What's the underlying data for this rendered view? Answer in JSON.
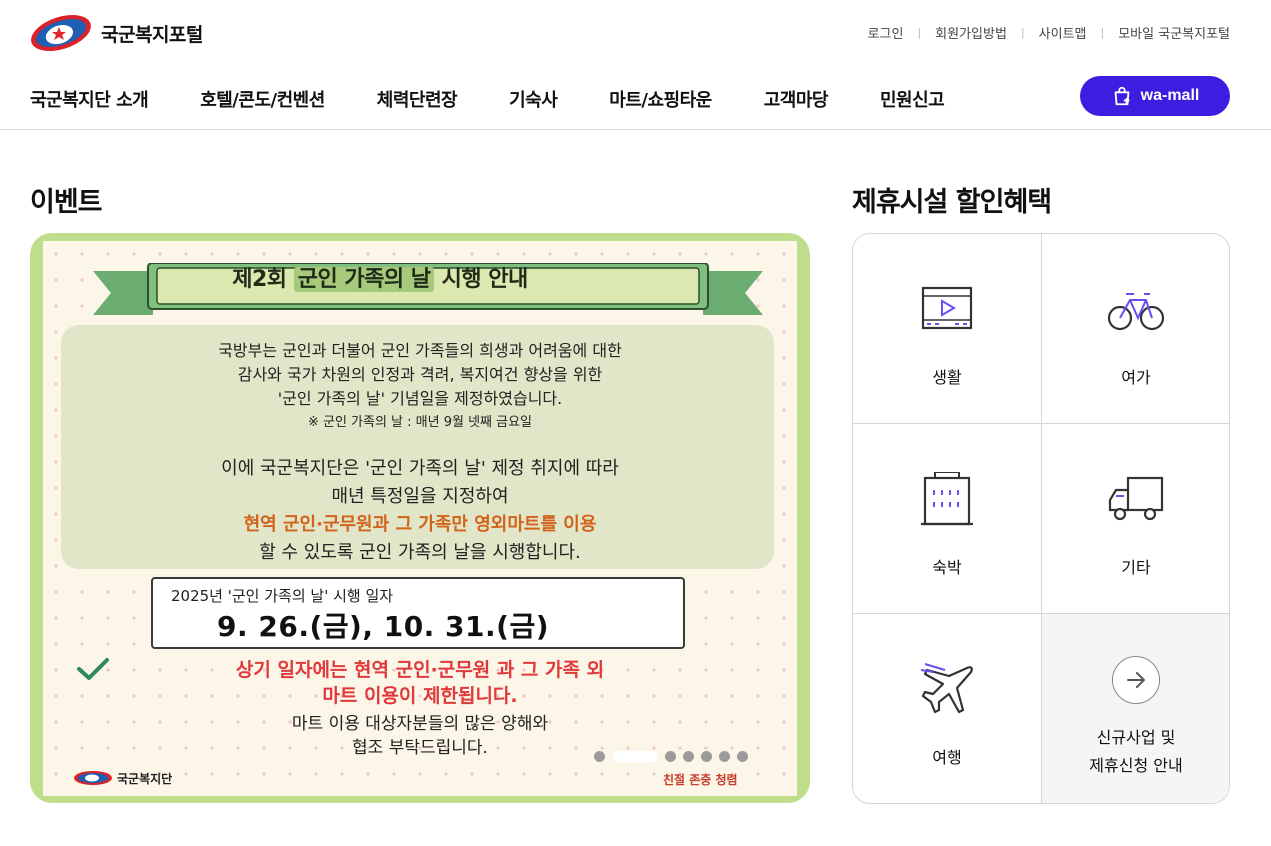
{
  "header": {
    "logo_text": "국군복지포털",
    "util_links": [
      "로그인",
      "회원가입방법",
      "사이트맵",
      "모바일 국군복지포털"
    ],
    "nav": [
      "국군복지단 소개",
      "호텔/콘도/컨벤션",
      "체력단련장",
      "기숙사",
      "마트/쇼핑타운",
      "고객마당",
      "민원신고"
    ],
    "wamall_label": "wa-mall",
    "wamall_color": "#3b1ee0"
  },
  "event": {
    "section_title": "이벤트",
    "banner": {
      "title_prefix": "제2회",
      "title_highlight": "군인 가족의 날",
      "title_suffix": "시행 안내",
      "intro_lines": [
        "국방부는 군인과 더불어 군인 가족들의 희생과 어려움에 대한",
        "감사와 국가 차원의 인정과 격려, 복지여건 향상을 위한",
        "'군인 가족의 날' 기념일을 제정하였습니다."
      ],
      "note": "※ 군인 가족의 날 : 매년 9월 넷째 금요일",
      "body_lines": [
        "이에 국군복지단은 '군인 가족의 날' 제정 취지에 따라",
        "매년 특정일을 지정하여"
      ],
      "highlight_line": "현역 군인·군무원과 그 가족만 영외마트를 이용",
      "body_last": "할 수 있도록 군인 가족의 날을 시행합니다.",
      "date_label": "2025년 '군인 가족의 날' 시행 일자",
      "date_value": "9. 26.(금), 10. 31.(금)",
      "warning_lines": [
        "상기 일자에는 현역 군인·군무원 과 그 가족 외",
        "마트 이용이 제한됩니다."
      ],
      "closing_lines": [
        "마트 이용 대상자분들의 많은 양해와",
        "협조 부탁드립니다."
      ],
      "footer_logo": "국군복지단",
      "footer_slogan": "친절 존중 청렴"
    },
    "slides_total": 7,
    "active_slide": 2
  },
  "partners": {
    "section_title": "제휴시설 할인혜택",
    "items": [
      {
        "label": "생활",
        "icon": "video-play-icon"
      },
      {
        "label": "여가",
        "icon": "bicycle-icon"
      },
      {
        "label": "숙박",
        "icon": "building-icon"
      },
      {
        "label": "기타",
        "icon": "truck-icon"
      },
      {
        "label": "여행",
        "icon": "airplane-icon"
      }
    ],
    "cta_lines": [
      "신규사업 및",
      "제휴신청 안내"
    ]
  }
}
